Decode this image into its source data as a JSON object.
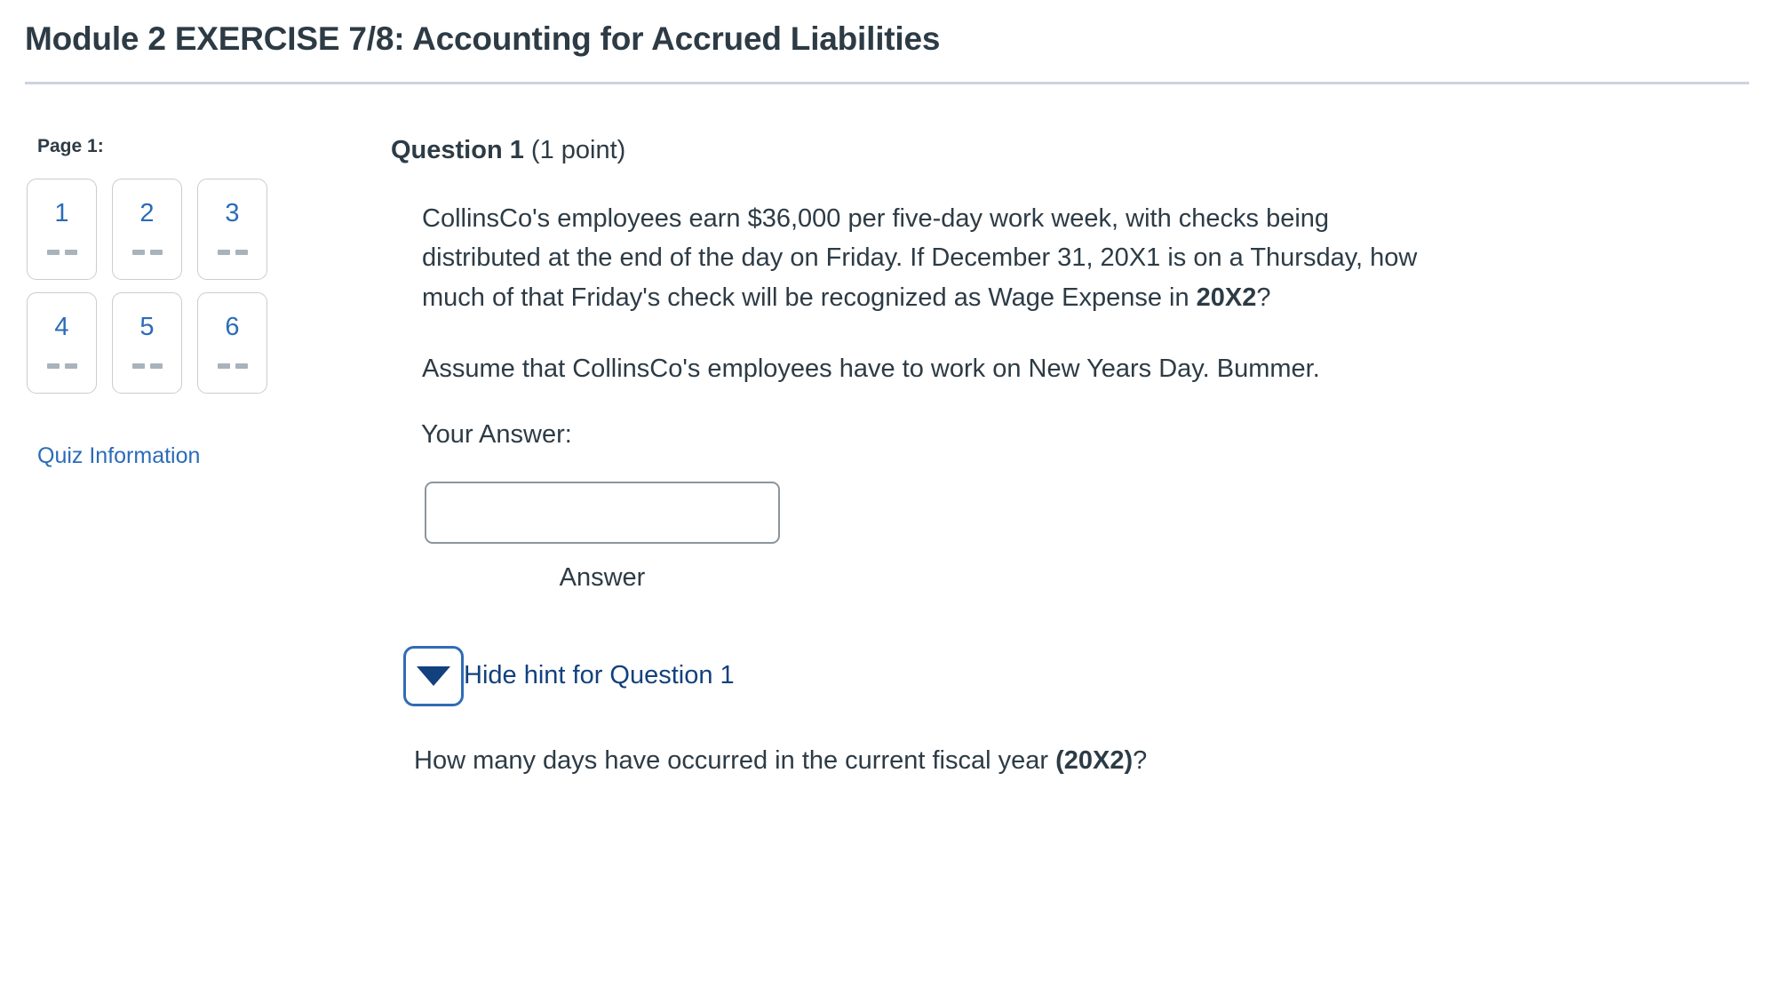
{
  "header": {
    "title": "Module 2 EXERCISE 7/8: Accounting for Accrued Liabilities"
  },
  "sidebar": {
    "page_label": "Page 1:",
    "question_buttons": [
      {
        "number": "1",
        "status": "--"
      },
      {
        "number": "2",
        "status": "--"
      },
      {
        "number": "3",
        "status": "--"
      },
      {
        "number": "4",
        "status": "--"
      },
      {
        "number": "5",
        "status": "--"
      },
      {
        "number": "6",
        "status": "--"
      }
    ],
    "quiz_information_label": "Quiz Information"
  },
  "question": {
    "name": "Question 1",
    "points": "(1 point)",
    "body_paragraph_1_part1": "CollinsCo's employees earn $36,000 per five-day work week, with checks being distributed at the end of the day on Friday.  If December 31, 20X1 is on a Thursday, how much of that Friday's check will be recognized as Wage Expense in ",
    "body_paragraph_1_bold": "20X2",
    "body_paragraph_1_part2": "?",
    "body_paragraph_2": "Assume that CollinsCo's employees have to work on New Years Day. Bummer.",
    "answer_label": "Your Answer:",
    "answer_value": "",
    "answer_placeholder": "",
    "answer_sub_label": "Answer",
    "hint_toggle_label": "Hide hint for Question 1",
    "hint_text_part1": "How many days have occurred in the current fiscal year ",
    "hint_text_bold": "(20X2)",
    "hint_text_part2": "?"
  },
  "colors": {
    "link_blue": "#2b6cb8",
    "hint_navy": "#12417e",
    "text": "#2d3b45",
    "border_gray": "#c7cdd1",
    "rule": "#ccd4de"
  }
}
